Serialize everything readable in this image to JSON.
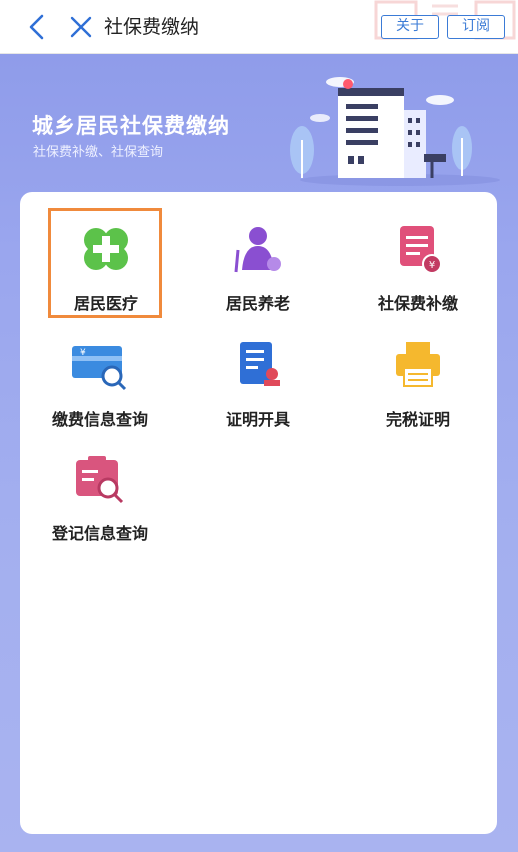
{
  "nav": {
    "title": "社保费缴纳",
    "about_label": "关于",
    "subscribe_label": "订阅"
  },
  "banner": {
    "title": "城乡居民社保费缴纳",
    "subtitle": "社保费补缴、社保查询"
  },
  "services": [
    {
      "label": "居民医疗",
      "icon": "medical-cross-icon",
      "color": "#5cc24a"
    },
    {
      "label": "居民养老",
      "icon": "elderly-icon",
      "color": "#8a4fd1"
    },
    {
      "label": "社保费补缴",
      "icon": "payment-doc-icon",
      "color": "#e0507a"
    },
    {
      "label": "缴费信息查询",
      "icon": "card-search-icon",
      "color": "#3b8be0"
    },
    {
      "label": "证明开具",
      "icon": "certificate-icon",
      "color": "#2f6fd6"
    },
    {
      "label": "完税证明",
      "icon": "printer-icon",
      "color": "#f5b82e"
    },
    {
      "label": "登记信息查询",
      "icon": "registration-search-icon",
      "color": "#d9557e"
    }
  ],
  "colors": {
    "accent": "#3b7bd6",
    "highlight": "#f08a3c",
    "background": "#9aa6ee"
  }
}
